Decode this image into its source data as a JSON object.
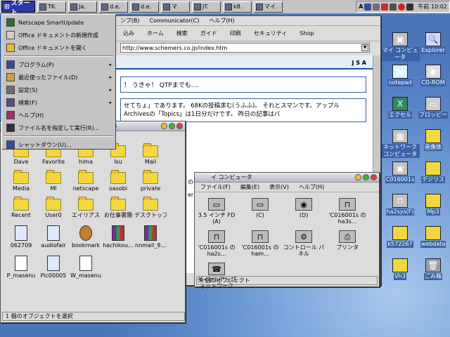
{
  "taskbar": {
    "start_label": "スタート",
    "buttons": [
      {
        "label": "TK."
      },
      {
        "label": "Ja."
      },
      {
        "label": "d.e."
      },
      {
        "label": "d.e."
      },
      {
        "label": "マ."
      },
      {
        "label": "JT."
      },
      {
        "label": "k8."
      },
      {
        "label": "マイ."
      }
    ],
    "clock": "午前 10:02",
    "tray_glyph": "A"
  },
  "start_menu": {
    "items": [
      {
        "label": "Netscape SmartUpdate",
        "arrow": ""
      },
      {
        "label": "Office ドキュメントの新規作成",
        "arrow": ""
      },
      {
        "label": "Office ドキュメントを開く",
        "arrow": ""
      },
      {
        "label": "プログラム(P)",
        "arrow": "▸"
      },
      {
        "label": "最近使ったファイル(D)",
        "arrow": "▸"
      },
      {
        "label": "設定(S)",
        "arrow": "▸"
      },
      {
        "label": "検索(F)",
        "arrow": "▸"
      },
      {
        "label": "ヘルプ(H)",
        "arrow": ""
      },
      {
        "label": "ファイル名を指定して実行(R)...",
        "arrow": ""
      },
      {
        "label": "シャットダウン(U)...",
        "arrow": ""
      }
    ]
  },
  "browser": {
    "menu": [
      "ンプ(B)",
      "Communicator(C)",
      "ヘルプ(H)"
    ],
    "toolbar": [
      "込み",
      "ホーム",
      "検索",
      "ガイド",
      "印刷",
      "セキュリティ",
      "Shop"
    ],
    "address": "http://www.schemers.co.jp/index.htm",
    "jsa": "J S A",
    "line1": "！ うきゃ！ QTPまでも....",
    "line2a": "せてちょ」であります。 68Kの投稿求む(うふふ)。 それとスマンです。アップル",
    "line2b": "Archivesの「Topics」は1日分だけです。 昨日の記事はバ",
    "gauge": "の Gauge"
  },
  "folder_window": {
    "status": "1 個のオブジェクトを選択",
    "items": [
      {
        "label": "Dave",
        "type": "folder"
      },
      {
        "label": "Favorite",
        "type": "folder"
      },
      {
        "label": "hima",
        "type": "folder"
      },
      {
        "label": "Isu",
        "type": "folder"
      },
      {
        "label": "Mail",
        "type": "folder"
      },
      {
        "label": "Media",
        "type": "folder"
      },
      {
        "label": "Ml",
        "type": "folder"
      },
      {
        "label": "netscape",
        "type": "folder"
      },
      {
        "label": "oasobi",
        "type": "folder"
      },
      {
        "label": "private",
        "type": "folder"
      },
      {
        "label": "Recent",
        "type": "folder"
      },
      {
        "label": "User0",
        "type": "folder"
      },
      {
        "label": "エイリアス",
        "type": "folder"
      },
      {
        "label": "お仕事書類",
        "type": "folder"
      },
      {
        "label": "デスクトップピクチャ",
        "type": "folder"
      },
      {
        "label": "062709",
        "type": "jpeg"
      },
      {
        "label": "audiofair",
        "type": "jpeg"
      },
      {
        "label": "bookmark",
        "type": "wheel"
      },
      {
        "label": "hachikou...",
        "type": "books"
      },
      {
        "label": "nnmail_9...",
        "type": "books"
      },
      {
        "label": "P_masenu",
        "type": "pdf"
      },
      {
        "label": "Pic00005",
        "type": "jpeg"
      },
      {
        "label": "W_masenu",
        "type": "pdf"
      }
    ]
  },
  "mycomputer": {
    "title_partial": "イ コンピュータ",
    "menu": [
      "ファイル(F)",
      "編集(E)",
      "表示(V)",
      "ヘルプ(H)"
    ],
    "drives": [
      {
        "label": "3.5 インチ FD (A)",
        "glyph": "▭"
      },
      {
        "label": "(C)",
        "glyph": "▭"
      },
      {
        "label": "(D)",
        "glyph": "◉"
      },
      {
        "label": "'C016001s の ha3s...",
        "glyph": "⊓"
      },
      {
        "label": "'C016001s の ha2s...",
        "glyph": "⊓"
      },
      {
        "label": "'C016001s の ham...",
        "glyph": "⊓"
      },
      {
        "label": "コントロール パネル",
        "glyph": "⚙"
      },
      {
        "label": "プリンタ",
        "glyph": "⎙"
      },
      {
        "label": "ダイヤルアップ ネットワーク",
        "glyph": "☎"
      }
    ],
    "status": "9 個のオブジェクト",
    "browser_status": "er"
  },
  "desktop_icons": [
    {
      "label": "マイ コンピュータ",
      "bg": "#c0c0c0",
      "glyph": "▣"
    },
    {
      "label": "Explorer",
      "bg": "#d0d8ff",
      "glyph": "🔍"
    },
    {
      "label": "notepad",
      "bg": "#e0f0ff",
      "glyph": "▤"
    },
    {
      "label": "CD-ROM",
      "bg": "#dddddd",
      "glyph": "◉"
    },
    {
      "label": "エクセル",
      "bg": "#2e8b57",
      "glyph": "X"
    },
    {
      "label": "フロッピー",
      "bg": "#cccccc",
      "glyph": "▭"
    },
    {
      "label": "ネットワーク コンピュータ",
      "bg": "#c0c0c0",
      "glyph": "▦"
    },
    {
      "label": "画像体",
      "bg": "#f2d83e",
      "glyph": ""
    },
    {
      "label": "C016001s",
      "bg": "#c0c0c0",
      "glyph": "▣"
    },
    {
      "label": "デジリス",
      "bg": "#f2d83e",
      "glyph": ""
    },
    {
      "label": "ha2sys(F)",
      "bg": "#c0c0c0",
      "glyph": "⊓"
    },
    {
      "label": "Mp3",
      "bg": "#f2d83e",
      "glyph": ""
    },
    {
      "label": "k572267",
      "bg": "#f2d83e",
      "glyph": ""
    },
    {
      "label": "webdata",
      "bg": "#f2d83e",
      "glyph": ""
    },
    {
      "label": "Vh3",
      "bg": "#f2d83e",
      "glyph": ""
    },
    {
      "label": "ごみ箱",
      "bg": "#9aa0a8",
      "glyph": "🗑"
    }
  ]
}
